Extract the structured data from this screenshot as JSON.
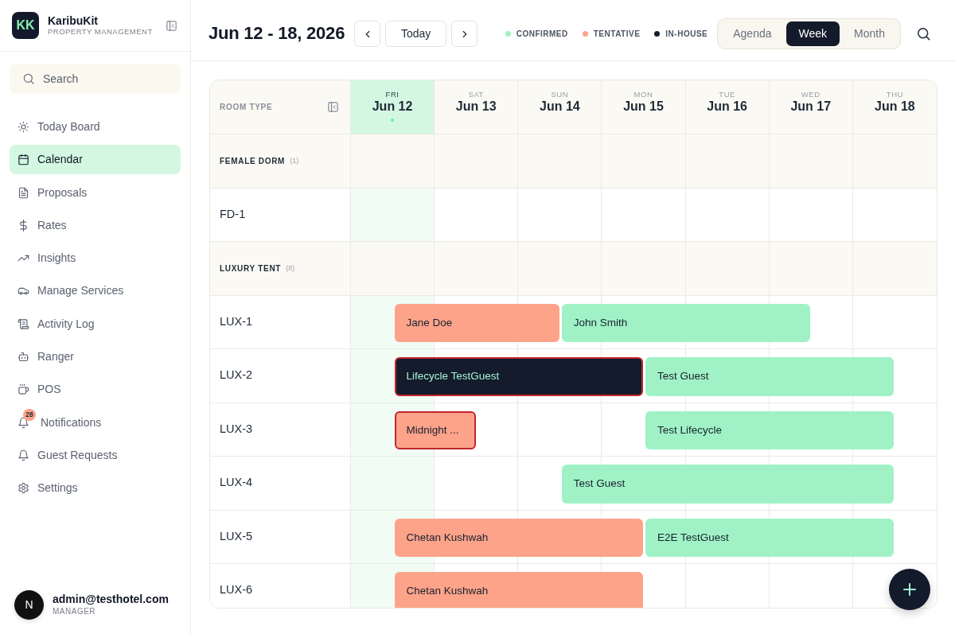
{
  "sidebar": {
    "brand": {
      "logo": "KK",
      "name": "KaribuKit",
      "tagline": "PROPERTY MANAGEMENT"
    },
    "search": {
      "placeholder": "Search"
    },
    "items": [
      {
        "label": "Today Board",
        "selected": false
      },
      {
        "label": "Calendar",
        "selected": true
      },
      {
        "label": "Proposals",
        "selected": false
      },
      {
        "label": "Rates",
        "selected": false
      },
      {
        "label": "Insights",
        "selected": false
      },
      {
        "label": "Manage Services",
        "selected": false
      },
      {
        "label": "Activity Log",
        "selected": false
      },
      {
        "label": "Ranger",
        "selected": false
      },
      {
        "label": "POS",
        "selected": false
      },
      {
        "label": "Notifications",
        "selected": false,
        "badge": "28"
      },
      {
        "label": "Guest Requests",
        "selected": false
      },
      {
        "label": "Settings",
        "selected": false
      }
    ],
    "user": {
      "initial": "N",
      "email": "admin@testhotel.com",
      "role": "MANAGER"
    }
  },
  "header": {
    "title": "Jun 12 - 18, 2026",
    "today_button": "Today",
    "legend": [
      {
        "kind": "confirmed",
        "label": "CONFIRMED",
        "color": "#a0f2c6"
      },
      {
        "kind": "tentative",
        "label": "TENTATIVE",
        "color": "#fca38a"
      },
      {
        "kind": "in-house",
        "label": "IN-HOUSE",
        "color": "#141b2d"
      }
    ],
    "views": [
      {
        "label": "Agenda",
        "selected": false
      },
      {
        "label": "Week",
        "selected": true
      },
      {
        "label": "Month",
        "selected": false
      }
    ]
  },
  "calendar": {
    "corner_label": "ROOM TYPE",
    "days": [
      {
        "weekday": "FRI",
        "date": "Jun 12",
        "today": true
      },
      {
        "weekday": "SAT",
        "date": "Jun 13",
        "today": false
      },
      {
        "weekday": "SUN",
        "date": "Jun 14",
        "today": false
      },
      {
        "weekday": "MON",
        "date": "Jun 15",
        "today": false
      },
      {
        "weekday": "TUE",
        "date": "Jun 16",
        "today": false
      },
      {
        "weekday": "WED",
        "date": "Jun 17",
        "today": false
      },
      {
        "weekday": "THU",
        "date": "Jun 18",
        "today": false
      }
    ],
    "groups": [
      {
        "name": "FEMALE DORM",
        "count": "(1)",
        "rooms": [
          {
            "name": "FD-1"
          }
        ]
      },
      {
        "name": "LUXURY TENT",
        "count": "(8)",
        "rooms": [
          {
            "name": "LUX-1",
            "nights": [
              {
                "kind": "tentative",
                "guest": "Jane Doe",
                "flagged": false
              },
              {
                "kind": "tentative"
              },
              {
                "kind": "confirmed",
                "guest": "John Smith",
                "flagged": false
              },
              {
                "kind": "confirmed"
              },
              {
                "kind": "confirmed"
              },
              {
                "kind": "vacant"
              },
              {
                "kind": "vacant"
              }
            ]
          },
          {
            "name": "LUX-2",
            "nights": [
              {
                "kind": "in-house",
                "guest": "Lifecycle TestGuest",
                "flagged": true
              },
              {
                "kind": "in-house"
              },
              {
                "kind": "in-house"
              },
              {
                "kind": "confirmed",
                "guest": "Test Guest",
                "flagged": false
              },
              {
                "kind": "confirmed"
              },
              {
                "kind": "confirmed"
              },
              {
                "kind": "vacant"
              }
            ]
          },
          {
            "name": "LUX-3",
            "nights": [
              {
                "kind": "tentative",
                "guest": "Midnight ...",
                "flagged": true
              },
              {
                "kind": "vacant"
              },
              {
                "kind": "vacant"
              },
              {
                "kind": "confirmed",
                "guest": "Test Lifecycle",
                "flagged": false
              },
              {
                "kind": "confirmed"
              },
              {
                "kind": "confirmed"
              },
              {
                "kind": "vacant"
              }
            ]
          },
          {
            "name": "LUX-4",
            "nights": [
              {
                "kind": "vacant"
              },
              {
                "kind": "vacant"
              },
              {
                "kind": "confirmed",
                "guest": "Test Guest",
                "flagged": false
              },
              {
                "kind": "confirmed"
              },
              {
                "kind": "confirmed"
              },
              {
                "kind": "confirmed"
              },
              {
                "kind": "vacant"
              }
            ]
          },
          {
            "name": "LUX-5",
            "nights": [
              {
                "kind": "tentative",
                "guest": "Chetan Kushwah",
                "flagged": false
              },
              {
                "kind": "tentative"
              },
              {
                "kind": "tentative"
              },
              {
                "kind": "confirmed",
                "guest": "E2E TestGuest",
                "flagged": false
              },
              {
                "kind": "confirmed"
              },
              {
                "kind": "confirmed"
              },
              {
                "kind": "vacant"
              }
            ]
          },
          {
            "name": "LUX-6",
            "nights": [
              {
                "kind": "tentative",
                "guest": "Chetan Kushwah",
                "flagged": false
              },
              {
                "kind": "tentative"
              },
              {
                "kind": "tentative"
              },
              {
                "kind": "vacant"
              },
              {
                "kind": "vacant"
              },
              {
                "kind": "vacant"
              },
              {
                "kind": "vacant"
              }
            ]
          }
        ]
      }
    ]
  }
}
